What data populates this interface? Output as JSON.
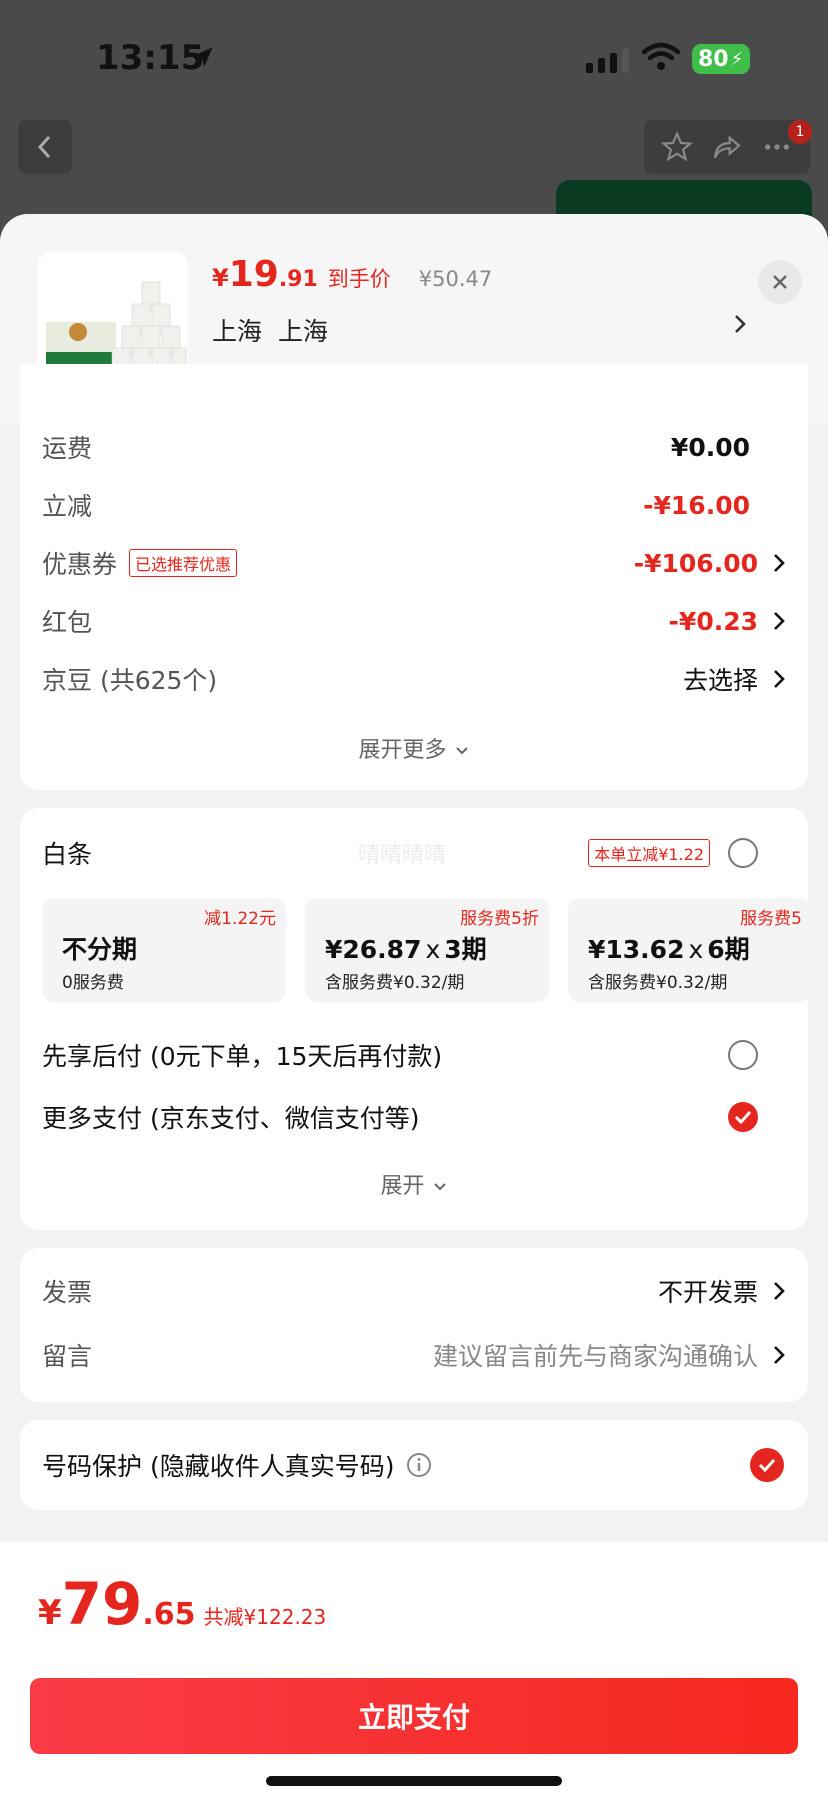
{
  "status_bar": {
    "time": "13:15",
    "battery": "80"
  },
  "top_bar": {
    "notification_count": "1"
  },
  "product": {
    "price_symbol": "¥",
    "price_int": "19",
    "price_dec": ".91",
    "price_tag": "到手价",
    "original_price": "¥50.47",
    "city": "上海",
    "district": "上海"
  },
  "fees": {
    "shipping_label": "运费",
    "shipping_value": "¥0.00",
    "discount_label": "立减",
    "discount_value": "-¥16.00",
    "coupon_label": "优惠券",
    "coupon_badge": "已选推荐优惠",
    "coupon_value": "-¥106.00",
    "redpacket_label": "红包",
    "redpacket_value": "-¥0.23",
    "jingdou_label": "京豆 (共625个)",
    "jingdou_value": "去选择",
    "expand_more": "展开更多"
  },
  "payment": {
    "baitiao_label": "白条",
    "baitiao_badge": "本单立减¥1.22",
    "plans": [
      {
        "corner": "减1.22元",
        "main": "不分期",
        "times": "",
        "periods": "",
        "sub": "0服务费"
      },
      {
        "corner": "服务费5折",
        "main": "¥26.87",
        "times": "x",
        "periods": "3期",
        "sub": "含服务费¥0.32/期"
      },
      {
        "corner": "服务费5",
        "main": "¥13.62",
        "times": "x",
        "periods": "6期",
        "sub": "含服务费¥0.32/期"
      }
    ],
    "paylater_label": "先享后付 (0元下单，15天后再付款)",
    "more_pay_label": "更多支付 (京东支付、微信支付等)",
    "expand": "展开",
    "watermark": "晴晴晴晴"
  },
  "invoice": {
    "invoice_label": "发票",
    "invoice_value": "不开发票",
    "note_label": "留言",
    "note_value": "建议留言前先与商家沟通确认"
  },
  "privacy": {
    "label": "号码保护 (隐藏收件人真实号码)"
  },
  "footer": {
    "total_symbol": "¥",
    "total_int": "79",
    "total_dec": ".65",
    "saved": "共减¥122.23",
    "pay_button": "立即支付"
  },
  "colors": {
    "accent": "#e4261e",
    "check": "#e4261e"
  }
}
